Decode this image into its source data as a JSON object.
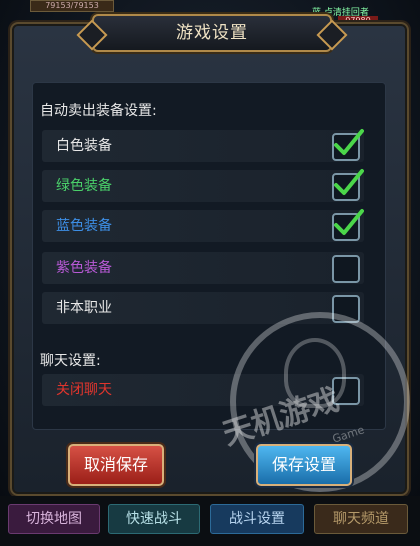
{
  "topbar": {
    "hp_text": "79153/79153",
    "right_text": "蓝 卢清挂回者",
    "right_num": "07980"
  },
  "dialog": {
    "title": "游戏设置",
    "section_equipment": "自动卖出装备设置:",
    "equipment_options": [
      {
        "label": "白色装备",
        "checked": true,
        "color": "#e8e8e8"
      },
      {
        "label": "绿色装备",
        "checked": true,
        "color": "#4ad06a"
      },
      {
        "label": "蓝色装备",
        "checked": true,
        "color": "#3d8fe6"
      },
      {
        "label": "紫色装备",
        "checked": false,
        "color": "#b85ad6"
      },
      {
        "label": "非本职业",
        "checked": false,
        "color": "#e8e8e8"
      }
    ],
    "section_chat": "聊天设置:",
    "chat_options": [
      {
        "label": "关闭聊天",
        "checked": false,
        "color": "#e0352d"
      }
    ],
    "cancel_label": "取消保存",
    "save_label": "保存设置"
  },
  "bottom_tabs": [
    {
      "label": "切换地图"
    },
    {
      "label": "快速战斗"
    },
    {
      "label": "战斗设置"
    },
    {
      "label": "聊天频道"
    }
  ],
  "watermark": {
    "text": "天机游戏",
    "sub": "Game"
  }
}
